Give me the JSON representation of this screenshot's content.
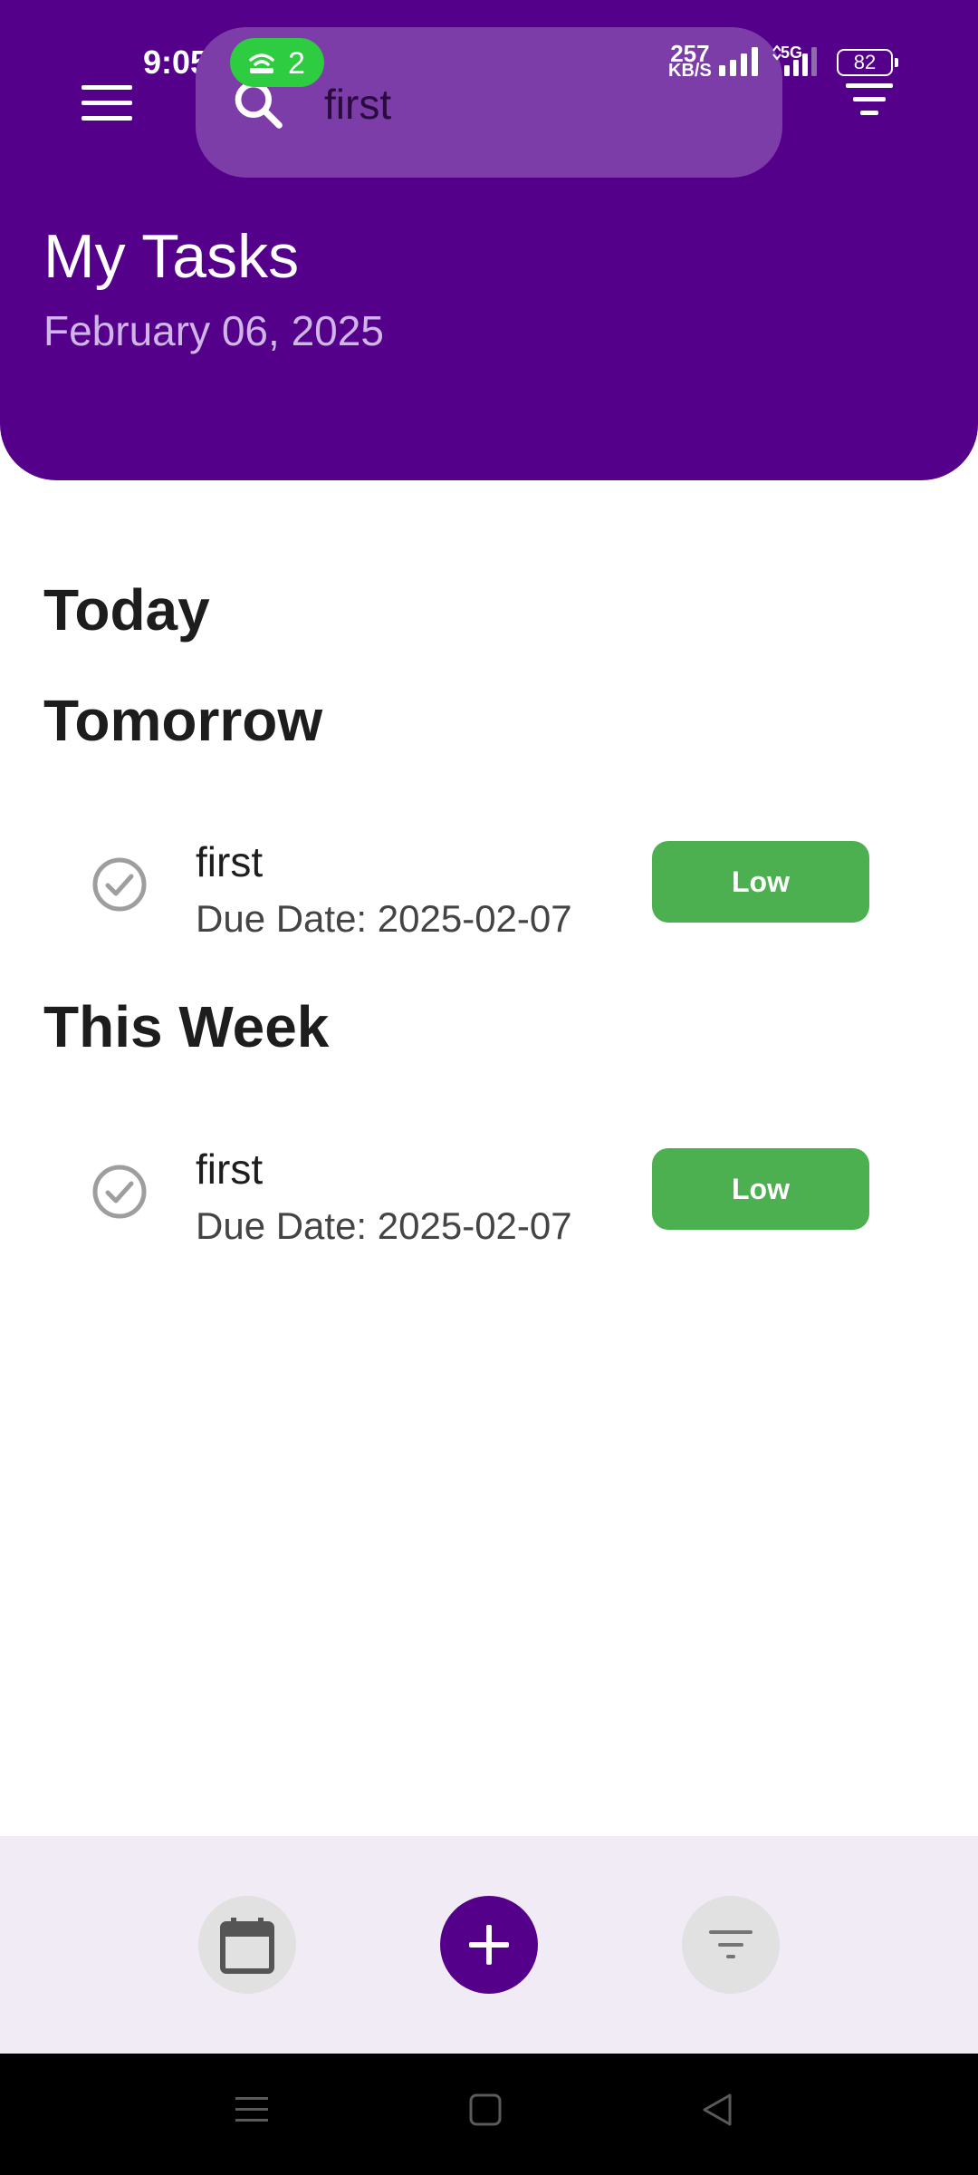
{
  "status_bar": {
    "time": "9:05",
    "hotspot_count": "2",
    "net_speed_value": "257",
    "net_speed_unit": "KB/S",
    "network_type": "5G",
    "battery": "82"
  },
  "header": {
    "search_value": "first",
    "title": "My Tasks",
    "date": "February 06, 2025"
  },
  "sections": [
    {
      "heading": "Today",
      "tasks": []
    },
    {
      "heading": "Tomorrow",
      "tasks": [
        {
          "title": "first",
          "due": "Due Date: 2025-02-07",
          "priority": "Low"
        }
      ]
    },
    {
      "heading": "This Week",
      "tasks": [
        {
          "title": "first",
          "due": "Due Date: 2025-02-07",
          "priority": "Low"
        }
      ]
    }
  ],
  "bottom_bar": {
    "icons": [
      "calendar-icon",
      "plus-icon",
      "filter-icon"
    ]
  },
  "colors": {
    "primary": "#55008b",
    "search_bg": "#7d3da9",
    "priority_low": "#4caf50",
    "bottom_bar_bg": "#f1ebf6"
  }
}
